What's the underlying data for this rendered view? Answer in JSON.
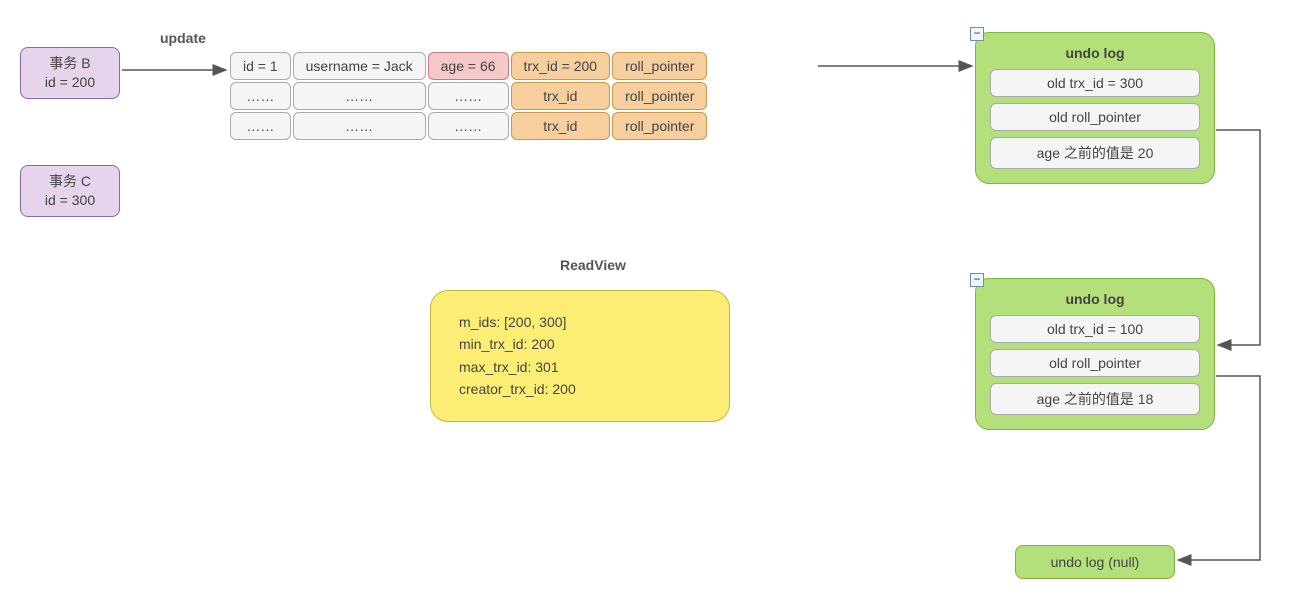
{
  "labels": {
    "update": "update",
    "readview_title": "ReadView"
  },
  "transactions": {
    "b": {
      "name": "事务 B",
      "id_line": "id = 200"
    },
    "c": {
      "name": "事务 C",
      "id_line": "id = 300"
    }
  },
  "table": {
    "rows": [
      {
        "c0": "id = 1",
        "c1": "username = Jack",
        "c2": "age = 66",
        "c3": "trx_id = 200",
        "c4": "roll_pointer"
      },
      {
        "c0": "……",
        "c1": "……",
        "c2": "……",
        "c3": "trx_id",
        "c4": "roll_pointer"
      },
      {
        "c0": "……",
        "c1": "……",
        "c2": "……",
        "c3": "trx_id",
        "c4": "roll_pointer"
      }
    ]
  },
  "readview": {
    "m_ids": "m_ids: [200, 300]",
    "min_trx_id": "min_trx_id: 200",
    "max_trx_id": "max_trx_id: 301",
    "creator_trx_id": "creator_trx_id: 200"
  },
  "undo1": {
    "title": "undo log",
    "r0": "old trx_id = 300",
    "r1": "old roll_pointer",
    "r2": "age 之前的值是 20"
  },
  "undo2": {
    "title": "undo log",
    "r0": "old trx_id = 100",
    "r1": "old roll_pointer",
    "r2": "age 之前的值是 18"
  },
  "undo_null": "undo log (null)"
}
